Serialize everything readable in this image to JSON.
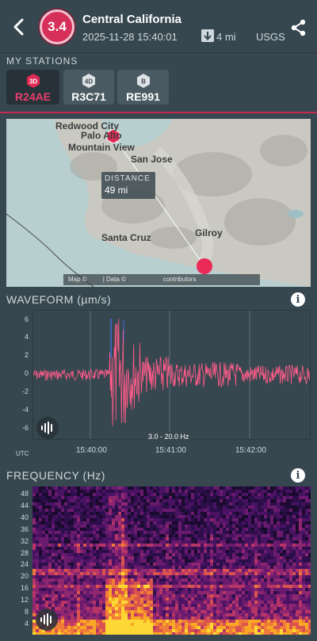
{
  "header": {
    "magnitude": "3.4",
    "title": "Central California",
    "datetime": "2025-11-28 15:40:01",
    "distance": "4 mi",
    "source": "USGS"
  },
  "stations": {
    "label": "MY STATIONS",
    "items": [
      {
        "badge": "3D",
        "code": "R24AE",
        "active": true
      },
      {
        "badge": "4D",
        "code": "R3C71",
        "active": false
      },
      {
        "badge": "B",
        "code": "RE991",
        "active": false
      }
    ]
  },
  "map": {
    "cities": [
      "Redwood City",
      "Palo Alto",
      "Mountain View",
      "San Jose",
      "Santa Cruz",
      "Gilroy"
    ],
    "station_marker": "3D",
    "tooltip_label": "DISTANCE",
    "tooltip_value": "49 mi",
    "attribution_prefix": "Map ©",
    "attribution_mid": " | Data ©",
    "attribution_suffix": " contributors"
  },
  "waveform": {
    "title": "WAVEFORM (µm/s)",
    "y_ticks": [
      "6",
      "4",
      "2",
      "0",
      "-2",
      "-4",
      "-6"
    ],
    "x_ticks": [
      "15:40:00",
      "15:41:00",
      "15:42:00"
    ],
    "utc_label": "UTC",
    "filter": "3.0 - 20.0 Hz",
    "trace_color": "#ff5c8a"
  },
  "frequency": {
    "title": "FREQUENCY (Hz)",
    "y_ticks": [
      "48",
      "44",
      "40",
      "36",
      "32",
      "28",
      "24",
      "20",
      "16",
      "12",
      "8",
      "4"
    ]
  },
  "colors": {
    "accent": "#d62f5a",
    "background": "#37474f"
  },
  "icons": {
    "back": "chevron-left-icon",
    "share": "share-icon",
    "info": "info-icon",
    "waveform": "sound-wave-icon"
  }
}
